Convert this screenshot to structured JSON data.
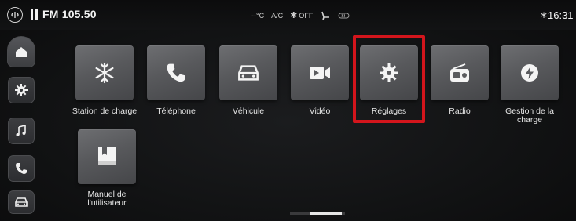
{
  "status_bar": {
    "radio_icon": "radio-signal-icon",
    "play_state_icon": "pause-icon",
    "station": "FM 105.50",
    "climate": {
      "temperature": "--°C",
      "ac": "A/C",
      "fan": "OFF"
    },
    "clock": "16:31",
    "bluetooth_icon": "bluetooth-icon"
  },
  "sidebar": {
    "items": [
      {
        "icon": "home-icon"
      },
      {
        "icon": "gear-icon"
      },
      {
        "icon": "music-note-icon"
      },
      {
        "icon": "phone-icon"
      },
      {
        "icon": "car-icon"
      }
    ]
  },
  "apps": [
    {
      "label": "Station de charge",
      "icon": "snowflake-icon"
    },
    {
      "label": "Téléphone",
      "icon": "phone-icon"
    },
    {
      "label": "Véhicule",
      "icon": "car-icon"
    },
    {
      "label": "Vidéo",
      "icon": "video-icon"
    },
    {
      "label": "Réglages",
      "icon": "gear-icon"
    },
    {
      "label": "Radio",
      "icon": "radio-icon"
    },
    {
      "label": "Gestion de la charge",
      "icon": "lightning-icon"
    },
    {
      "label": "Manuel de l'utilisateur",
      "icon": "book-icon"
    }
  ],
  "highlighted_app": "Réglages",
  "colors": {
    "highlight": "#d3151c",
    "background": "#111213",
    "tile": "#5c5d60"
  }
}
